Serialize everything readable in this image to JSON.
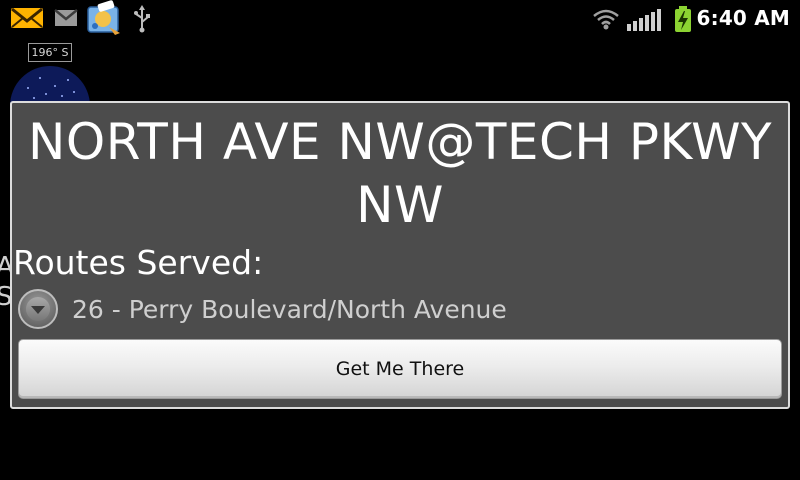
{
  "status_bar": {
    "time": "6:40 AM",
    "icons": [
      "email-notification-icon",
      "gmail-icon",
      "app-notification-icon",
      "usb-icon",
      "wifi-icon",
      "signal-icon",
      "battery-charging-icon"
    ]
  },
  "background": {
    "compass_heading": "196° S",
    "left_edge_text_line1": "A",
    "left_edge_text_line2": "S"
  },
  "dialog": {
    "stop_name_line1": "NORTH AVE NW@TECH PKWY",
    "stop_name_line2": "NW",
    "routes_label": "Routes Served:",
    "routes": [
      {
        "name": "26 - Perry Boulevard/North Avenue"
      }
    ],
    "primary_button_label": "Get Me There"
  },
  "colors": {
    "dialog_background": "#4c4c4c",
    "dialog_border": "#dcdcdc",
    "battery": "#8cd332"
  }
}
